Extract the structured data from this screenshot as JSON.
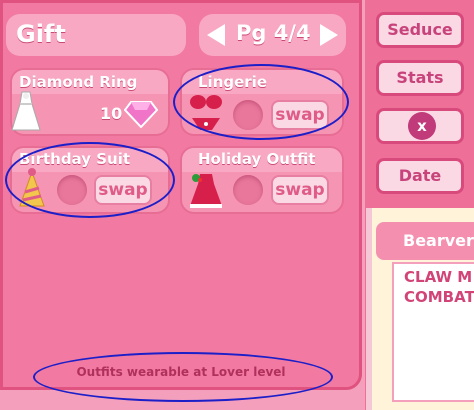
{
  "header": {
    "title": "Gift",
    "page_label": "Pg 4/4"
  },
  "items": [
    {
      "name": "Diamond Ring",
      "price": "10",
      "icon": "wedding-dress-icon",
      "price_icon": "gem-icon"
    },
    {
      "name": "Lingerie",
      "button": "swap",
      "icon": "lingerie-icon"
    },
    {
      "name": "Birthday Suit",
      "button": "swap",
      "icon": "party-hat-icon"
    },
    {
      "name": "Holiday Outfit",
      "button": "swap",
      "icon": "holiday-dress-icon"
    }
  ],
  "footer": {
    "note": "Outfits wearable at Lover level"
  },
  "side_menu": {
    "seduce": "Seduce",
    "stats": "Stats",
    "close": "x",
    "date": "Date"
  },
  "info": {
    "name": "Bearverly",
    "desc_line1": "CLAW M",
    "desc_line2": "COMBAT"
  },
  "colors": {
    "panel": "#f27aa2",
    "card": "#f594b3",
    "annotation": "#1c1fc8",
    "accent": "#c13a7a"
  }
}
